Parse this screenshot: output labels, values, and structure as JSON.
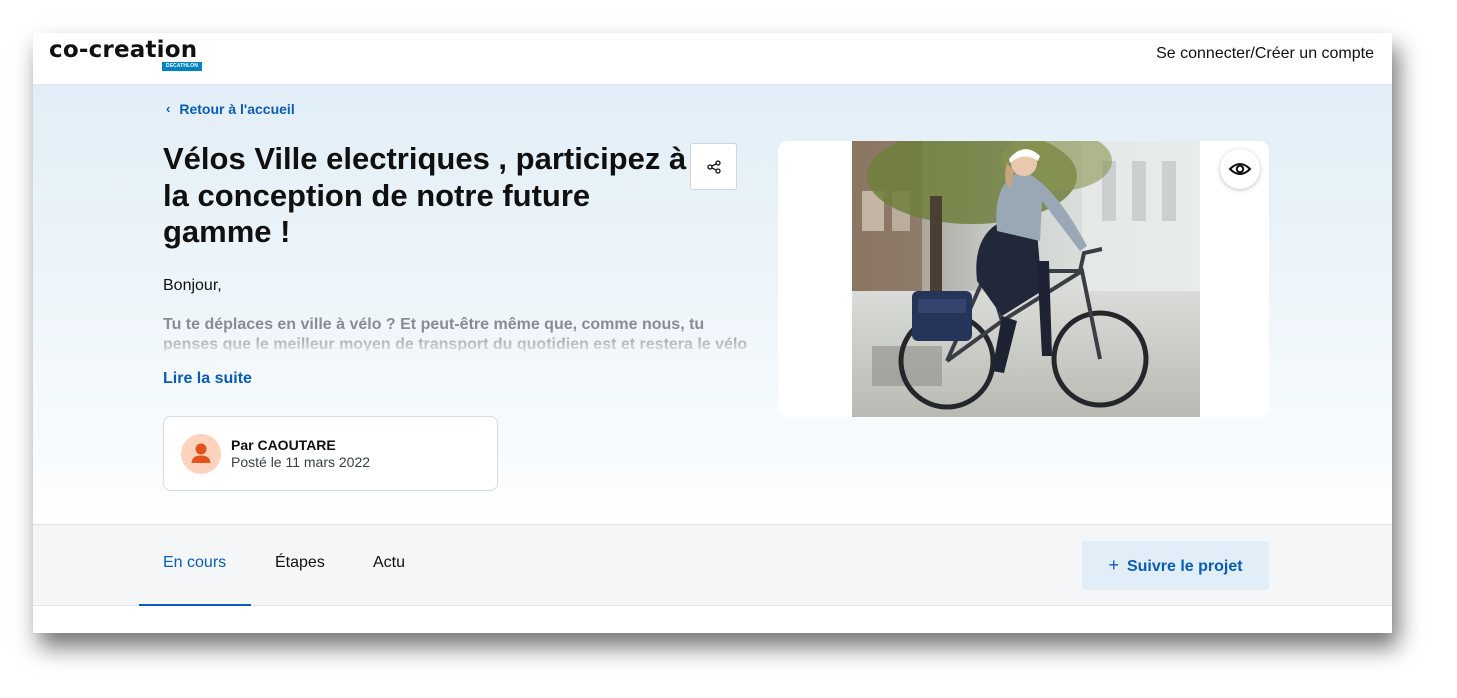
{
  "header": {
    "logo_text": "co-creation",
    "logo_badge": "DECATHLON",
    "login_label": "Se connecter/Créer un compte"
  },
  "hero": {
    "back_label": "Retour à l'accueil",
    "title": "Vélos Ville electriques , participez à la conception de notre future gamme !",
    "greeting": "Bonjour,",
    "excerpt": "Tu te déplaces en ville à vélo ? Et peut-être même que, comme nous, tu penses que le meilleur moyen de transport du quotidien est et restera le vélo ? Alors",
    "read_more": "Lire la suite",
    "author": {
      "name": "Par CAOUTARE",
      "posted": "Posté le 11 mars 2022"
    },
    "share_icon": "share-icon",
    "view_icon": "eye-icon"
  },
  "tabs": [
    {
      "label": "En cours",
      "active": true
    },
    {
      "label": "Étapes",
      "active": false
    },
    {
      "label": "Actu",
      "active": false
    }
  ],
  "follow_button": {
    "icon": "+",
    "label": "Suivre le projet"
  },
  "colors": {
    "accent": "#0a5db5",
    "hero_bg": "#e2eef7",
    "avatar_bg": "#fdd3bd",
    "avatar_fg": "#e3531c"
  }
}
